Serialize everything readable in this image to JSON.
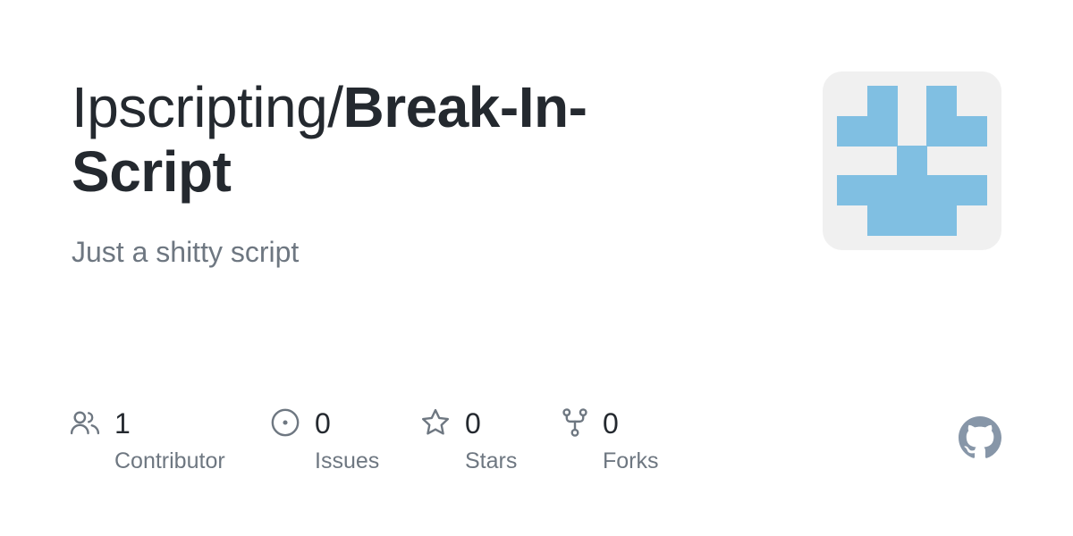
{
  "repo": {
    "owner": "Ipscripting",
    "separator": "/",
    "name": "Break-In-Script",
    "description": "Just a shitty script"
  },
  "stats": {
    "contributors": {
      "count": "1",
      "label": "Contributor",
      "icon": "people-icon"
    },
    "issues": {
      "count": "0",
      "label": "Issues",
      "icon": "issue-opened-icon"
    },
    "stars": {
      "count": "0",
      "label": "Stars",
      "icon": "star-icon"
    },
    "forks": {
      "count": "0",
      "label": "Forks",
      "icon": "repo-forked-icon"
    }
  },
  "avatar": {
    "icon": "identicon-avatar",
    "color": "#80bfe2",
    "background": "#f0f0f0"
  },
  "brand": {
    "icon": "github-mark-icon",
    "color": "#8796a8"
  },
  "colors": {
    "title": "#24292f",
    "muted": "#6e7781",
    "icon": "#6e7781"
  }
}
